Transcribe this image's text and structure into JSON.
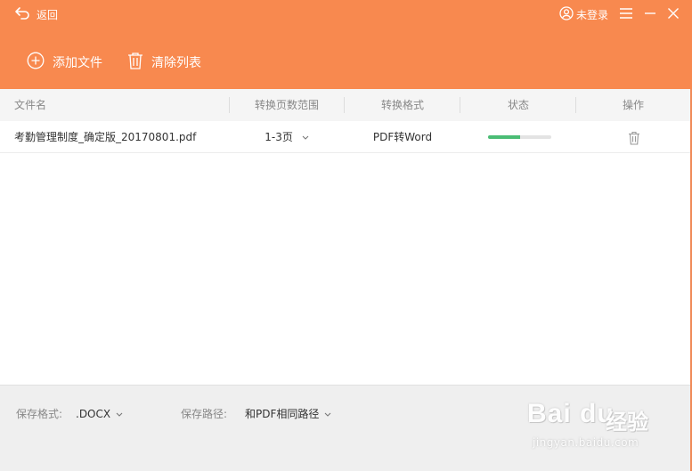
{
  "header": {
    "back_label": "返回",
    "login_label": "未登录",
    "add_file_label": "添加文件",
    "clear_list_label": "清除列表"
  },
  "table": {
    "columns": [
      "文件名",
      "转换页数范围",
      "转换格式",
      "状态",
      "操作"
    ],
    "rows": [
      {
        "filename": "考勤管理制度_确定版_20170801.pdf",
        "page_range": "1-3页",
        "format": "PDF转Word",
        "progress": 0.5
      }
    ]
  },
  "footer": {
    "save_format_label": "保存格式:",
    "save_format_value": ".DOCX",
    "save_path_label": "保存路径:",
    "save_path_value": "和PDF相同路径"
  },
  "watermark": {
    "brand": "Bai du",
    "brand_suffix": "经验",
    "url": "jingyan.baidu.com"
  },
  "colors": {
    "accent": "#f8894f",
    "progress": "#4bbd75"
  }
}
